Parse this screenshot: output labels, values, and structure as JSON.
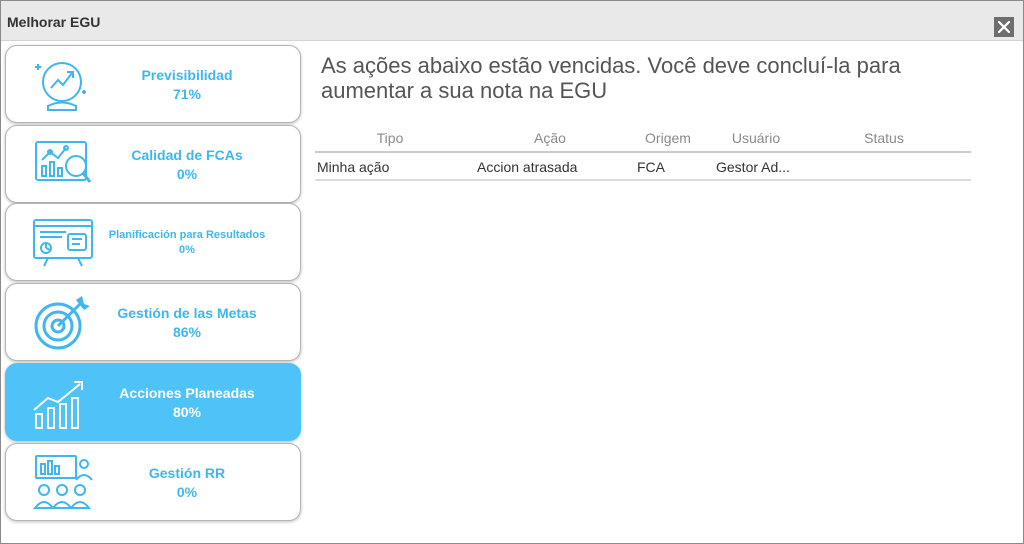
{
  "window": {
    "title": "Melhorar EGU",
    "close_label": "✕"
  },
  "colors": {
    "accent": "#4fc3f7",
    "text_accent": "#3fb6ee"
  },
  "sidebar": {
    "items": [
      {
        "name": "Previsibilidad",
        "percent": "71%",
        "icon": "crystal-ball-chart-icon",
        "active": false
      },
      {
        "name": "Calidad de FCAs",
        "percent": "0%",
        "icon": "chart-magnifier-icon",
        "active": false
      },
      {
        "name": "Planificación para Resultados",
        "percent": "0%",
        "icon": "presentation-board-icon",
        "active": false
      },
      {
        "name": "Gestión de las Metas",
        "percent": "86%",
        "icon": "target-arrow-icon",
        "active": false
      },
      {
        "name": "Acciones Planeadas",
        "percent": "80%",
        "icon": "growth-bars-icon",
        "active": true
      },
      {
        "name": "Gestión RR",
        "percent": "0%",
        "icon": "team-presentation-icon",
        "active": false
      }
    ]
  },
  "main": {
    "heading": "As ações abaixo estão vencidas. Você deve concluí-la para aumentar a sua nota na EGU",
    "table": {
      "headers": [
        "Tipo",
        "Ação",
        "Origem",
        "Usuário",
        "Status"
      ],
      "rows": [
        [
          "Minha ação",
          "Accion atrasada",
          "FCA",
          "Gestor Ad...",
          ""
        ]
      ]
    }
  }
}
